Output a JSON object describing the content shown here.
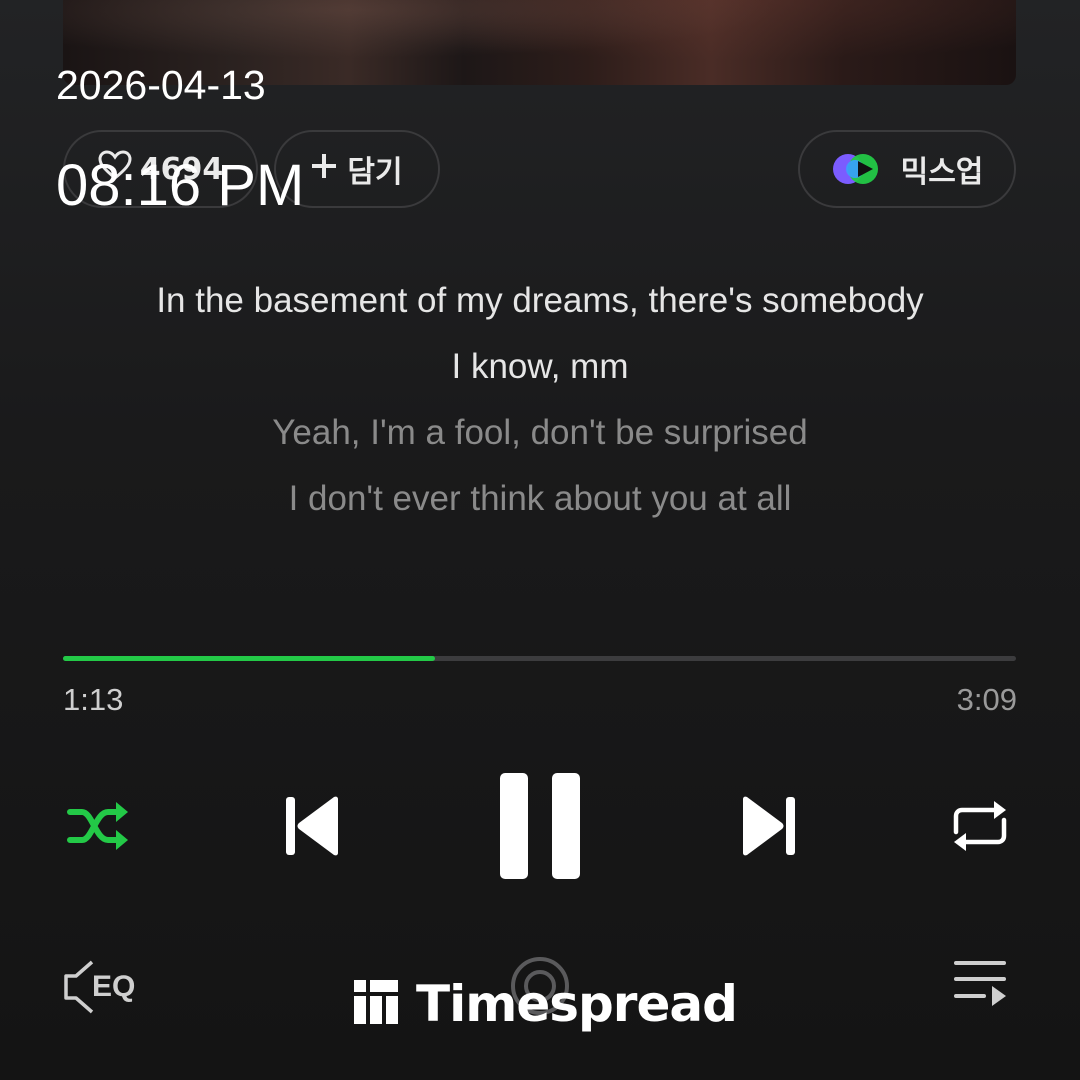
{
  "overlay": {
    "date": "2026-04-13",
    "time": "08:16 PM"
  },
  "actions": {
    "like_count": "4694",
    "add_label": "담기",
    "mixup_label": "믹스업"
  },
  "lyrics": [
    {
      "text": "In the basement of my dreams, there's somebody",
      "state": "active"
    },
    {
      "text": "I know, mm",
      "state": "active"
    },
    {
      "text": "Yeah, I'm a fool, don't be surprised",
      "state": "dim"
    },
    {
      "text": "I don't ever think about you at all",
      "state": "dim"
    }
  ],
  "playback": {
    "elapsed": "1:13",
    "total": "3:09",
    "progress_fraction": 0.39,
    "shuffle_on": true,
    "is_playing": true
  },
  "bottom_bar": {
    "eq_label": "EQ"
  },
  "watermark": {
    "text": "Timespread"
  },
  "colors": {
    "accent_green": "#23c947",
    "background": "#161616",
    "text_primary": "#e6e6e6",
    "text_dim": "#8a8a8a"
  }
}
